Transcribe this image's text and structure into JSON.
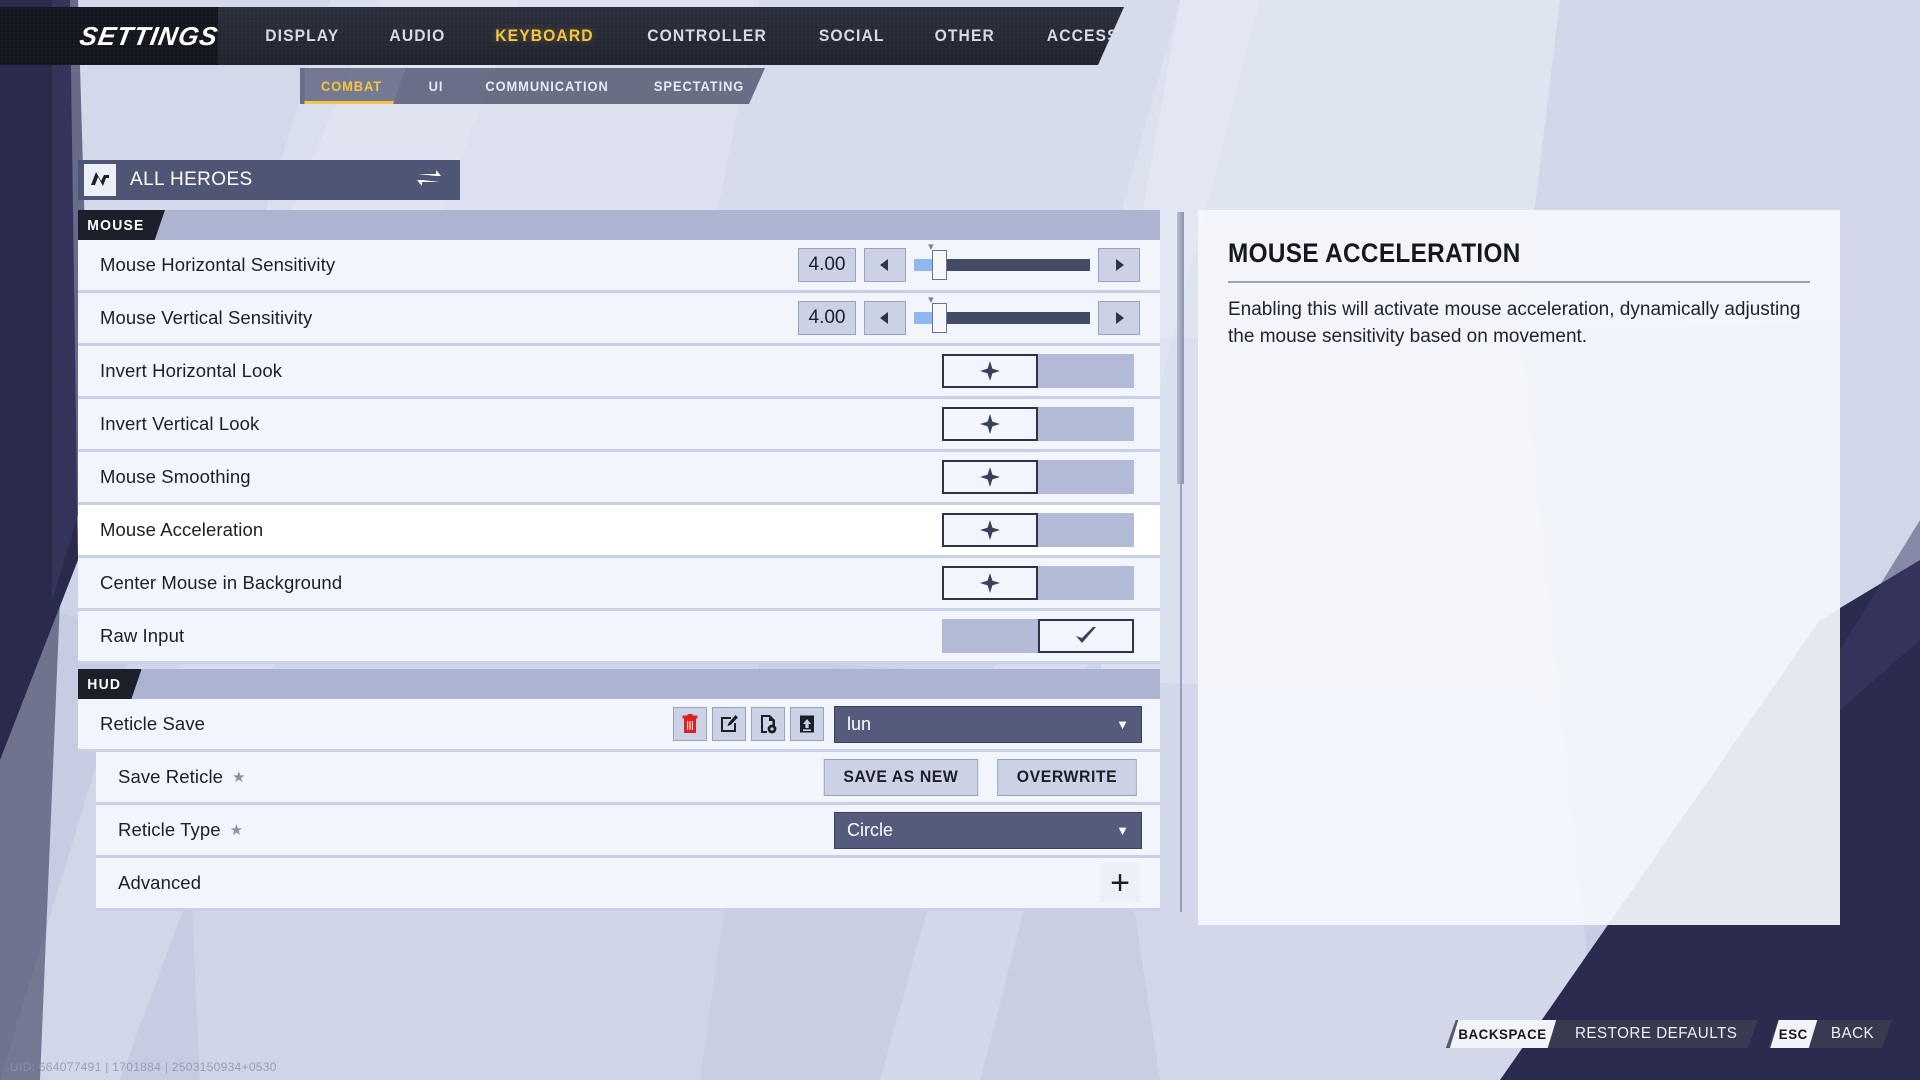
{
  "header": {
    "title": "SETTINGS",
    "tabs": [
      {
        "label": "DISPLAY",
        "active": false
      },
      {
        "label": "AUDIO",
        "active": false
      },
      {
        "label": "KEYBOARD",
        "active": true
      },
      {
        "label": "CONTROLLER",
        "active": false
      },
      {
        "label": "SOCIAL",
        "active": false
      },
      {
        "label": "OTHER",
        "active": false
      },
      {
        "label": "ACCESSIBILITY",
        "active": false
      }
    ]
  },
  "subtabs": [
    {
      "label": "COMBAT",
      "active": true
    },
    {
      "label": "UI",
      "active": false
    },
    {
      "label": "COMMUNICATION",
      "active": false
    },
    {
      "label": "SPECTATING",
      "active": false
    }
  ],
  "hero_select": {
    "label": "ALL HEROES",
    "icon": "all-heroes-icon",
    "swap_icon": "swap-arrows-icon"
  },
  "sections": [
    {
      "tag": "MOUSE",
      "rows": [
        {
          "label": "Mouse Horizontal Sensitivity",
          "type": "slider",
          "value": "4.00",
          "fill_percent": 11,
          "knob_percent": 11
        },
        {
          "label": "Mouse Vertical Sensitivity",
          "type": "slider",
          "value": "4.00",
          "fill_percent": 11,
          "knob_percent": 11
        },
        {
          "label": "Invert Horizontal Look",
          "type": "toggle",
          "state": "off"
        },
        {
          "label": "Invert Vertical Look",
          "type": "toggle",
          "state": "off"
        },
        {
          "label": "Mouse Smoothing",
          "type": "toggle",
          "state": "off"
        },
        {
          "label": "Mouse Acceleration",
          "type": "toggle",
          "state": "off",
          "highlight": true
        },
        {
          "label": "Center Mouse in Background",
          "type": "toggle",
          "state": "off"
        },
        {
          "label": "Raw Input",
          "type": "toggle",
          "state": "on"
        }
      ]
    },
    {
      "tag": "HUD",
      "rows": [
        {
          "label": "Reticle Save",
          "type": "reticle-save",
          "value": "lun"
        },
        {
          "label": "Save Reticle",
          "starred": true,
          "type": "buttons",
          "buttons": [
            "SAVE AS NEW",
            "OVERWRITE"
          ],
          "indent": true
        },
        {
          "label": "Reticle Type",
          "starred": true,
          "type": "dropdown",
          "value": "Circle",
          "indent": true
        },
        {
          "label": "Advanced",
          "type": "expand",
          "indent": true
        }
      ]
    }
  ],
  "reticle_icons": [
    {
      "name": "delete-reticle-icon",
      "glyph": "trash",
      "color": "#e02020"
    },
    {
      "name": "edit-reticle-icon",
      "glyph": "pencil",
      "color": "#1c1f27"
    },
    {
      "name": "import-reticle-icon",
      "glyph": "file-add",
      "color": "#1c1f27"
    },
    {
      "name": "export-reticle-icon",
      "glyph": "upload",
      "color": "#1c1f27"
    }
  ],
  "info_panel": {
    "title": "MOUSE ACCELERATION",
    "body": "Enabling this will activate mouse acceleration, dynamically adjusting the mouse sensitivity based on movement."
  },
  "bottom_hints": [
    {
      "key": "BACKSPACE",
      "label": "RESTORE DEFAULTS"
    },
    {
      "key": "ESC",
      "label": "BACK"
    }
  ],
  "uid": "UID: 664077491 | 1701884 | 2503150934+0530",
  "colors": {
    "accent_yellow": "#f5c542",
    "header_dark": "#22252f",
    "panel_bg": "#f3f5fc",
    "row_divider": "#c9cfe4",
    "dropdown_bg": "#545b7c",
    "slider_track": "#434a63",
    "slider_fill": "#8fb7f0",
    "delete_red": "#e02020"
  },
  "scroll": {
    "thumb_top_pct": 0,
    "thumb_height_pct": 39
  }
}
